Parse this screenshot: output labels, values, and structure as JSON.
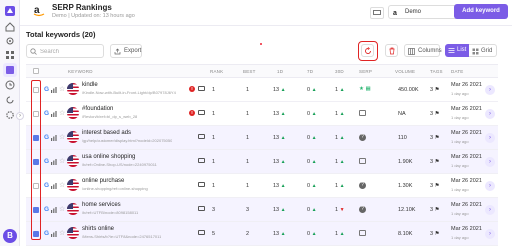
{
  "header": {
    "title": "SERP Rankings",
    "subtitle": "Demo | Updated on: 13 hours ago",
    "project_select": "Demo",
    "add_button": "Add keyword"
  },
  "toolbar": {
    "total_label": "Total keywords (20)",
    "search_placeholder": "Search",
    "export_label": "Export",
    "columns_label": "Columns",
    "list_label": "List",
    "grid_label": "Grid"
  },
  "table": {
    "headers": {
      "keyword": "KEYWORD",
      "rank": "RANK",
      "best": "BEST",
      "d1": "1D",
      "d7": "7D",
      "d30": "30D",
      "serp": "SERP",
      "volume": "VOLUME",
      "tags": "TAGS",
      "date": "DATE"
    },
    "rows": [
      {
        "selected": false,
        "keyword": "kindle",
        "url": "/Kindle-Now-with-Built-in-Front-Light/dp/B07978J6Y4",
        "has_error": true,
        "rank": "1",
        "best": "1",
        "d1": "13",
        "d1_dir": "up",
        "d7": "0",
        "d7_dir": "up",
        "d30": "1",
        "d30_dir": "up",
        "volume": "450.00K",
        "tags": "3",
        "date": "Mar 26 2021",
        "date_sub": "1 day ago"
      },
      {
        "selected": false,
        "keyword": "#foundation",
        "url": "/Revlon/b/ref=bl_dp_s_web_28",
        "has_error": true,
        "rank": "1",
        "best": "1",
        "d1": "13",
        "d1_dir": "up",
        "d7": "0",
        "d7_dir": "up",
        "d30": "1",
        "d30_dir": "up",
        "volume": "NA",
        "tags": "3",
        "date": "Mar 26 2021",
        "date_sub": "1 day ago"
      },
      {
        "selected": true,
        "keyword": "interest based ads",
        "url": "/gp/help/customer/display.html?nodeld=202075050",
        "has_error": false,
        "rank": "1",
        "best": "1",
        "d1": "13",
        "d1_dir": "up",
        "d7": "0",
        "d7_dir": "up",
        "d30": "1",
        "d30_dir": "up",
        "volume": "110",
        "tags": "3",
        "date": "Mar 26 2021",
        "date_sub": "1 day ago"
      },
      {
        "selected": true,
        "keyword": "usa online shopping",
        "url": "/b/ref=Online-Shop-US/node=2240975011",
        "has_error": false,
        "rank": "1",
        "best": "1",
        "d1": "13",
        "d1_dir": "up",
        "d7": "0",
        "d7_dir": "up",
        "d30": "1",
        "d30_dir": "up",
        "volume": "1.90K",
        "tags": "3",
        "date": "Mar 26 2021",
        "date_sub": "1 day ago"
      },
      {
        "selected": false,
        "keyword": "online purchase",
        "url": "/online-shopping/ref=online-shopping",
        "has_error": false,
        "rank": "1",
        "best": "1",
        "d1": "13",
        "d1_dir": "up",
        "d7": "0",
        "d7_dir": "up",
        "d30": "1",
        "d30_dir": "up",
        "volume": "1.30K",
        "tags": "3",
        "date": "Mar 26 2021",
        "date_sub": "1 day ago"
      },
      {
        "selected": true,
        "keyword": "home services",
        "url": "/b/ref=UTFB/node=8098158011",
        "has_error": false,
        "rank": "3",
        "best": "3",
        "d1": "13",
        "d1_dir": "up",
        "d7": "0",
        "d7_dir": "up",
        "d30": "1",
        "d30_dir": "down",
        "volume": "12.10K",
        "tags": "3",
        "date": "Mar 26 2021",
        "date_sub": "1 day ago"
      },
      {
        "selected": true,
        "keyword": "shirts online",
        "url": "/Mens-Shirts/b?ie=UTF8&node=2476517011",
        "has_error": false,
        "rank": "5",
        "best": "2",
        "d1": "13",
        "d1_dir": "up",
        "d7": "0",
        "d7_dir": "up",
        "d30": "1",
        "d30_dir": "up",
        "volume": "8.10K",
        "tags": "3",
        "date": "Mar 26 2021",
        "date_sub": "1 day ago"
      }
    ]
  }
}
